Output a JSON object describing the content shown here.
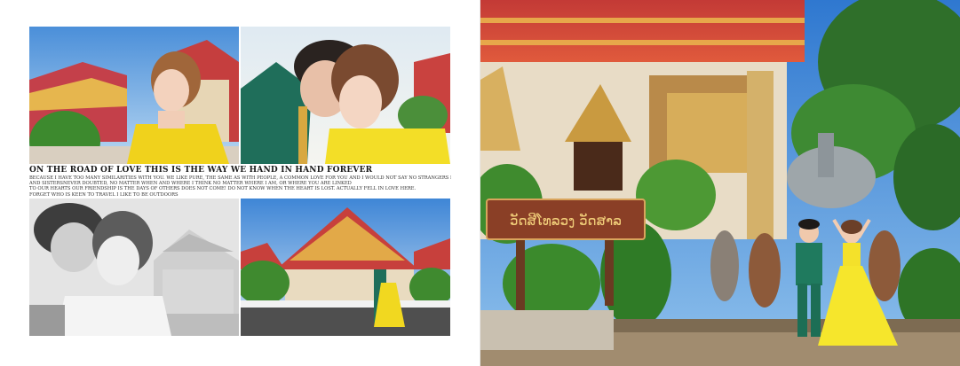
{
  "album": {
    "left_page": {
      "headline": "ON THE ROAD OF LOVE THIS IS THE WAY WE HAND IN HAND FOREVER",
      "body_lines": [
        "Because I have too many similarities with you. We like pure, the same as with people, a common love for you and I would not say no strangers become brothers",
        "and sistersNever doubted, no matter when and where I think no matter where I am, or where you are linked",
        "To our hearts our friendship is the days of others does not come! Do not know when the heart is lost. Actually fell in love here.",
        "forget who is keen to travel I like to be outdoors"
      ]
    },
    "right_page": {
      "temple_sign_text": "ວັດສີໂທລວງ ວັດສາລ"
    }
  }
}
